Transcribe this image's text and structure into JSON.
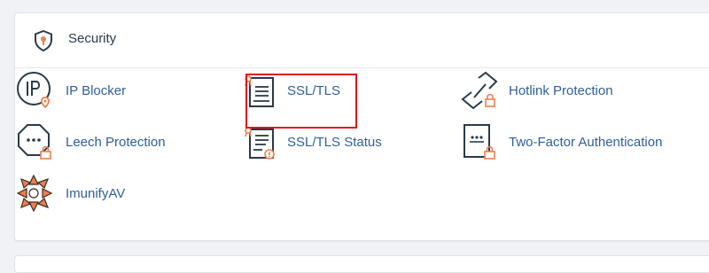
{
  "section": {
    "title": "Security",
    "icon": "shield-keyhole-icon"
  },
  "items": [
    {
      "label": "IP Blocker",
      "icon": "ip-blocker-icon"
    },
    {
      "label": "SSL/TLS",
      "icon": "ssl-certificate-icon",
      "highlighted": true
    },
    {
      "label": "Hotlink Protection",
      "icon": "hotlink-chain-icon"
    },
    {
      "label": "Leech Protection",
      "icon": "leech-protection-icon"
    },
    {
      "label": "SSL/TLS Status",
      "icon": "ssl-status-icon"
    },
    {
      "label": "Two-Factor Authentication",
      "icon": "two-factor-icon"
    },
    {
      "label": "ImunifyAV",
      "icon": "imunifyav-icon"
    }
  ],
  "colors": {
    "link": "#2f5f97",
    "icon_dark": "#293a4a",
    "accent_orange": "#ee7f4c",
    "highlight_border": "#e3141a"
  }
}
